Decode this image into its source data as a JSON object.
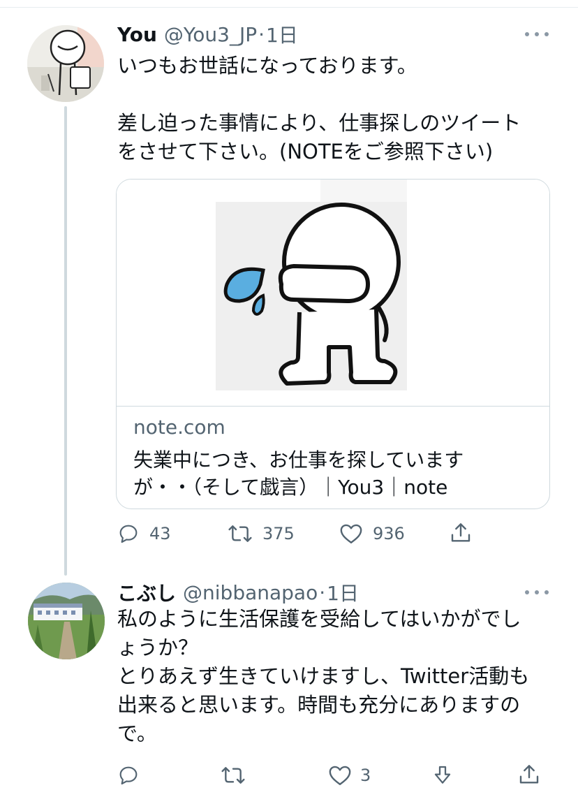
{
  "tweets": [
    {
      "author_name": "You",
      "handle": "@You3_JP",
      "separator": "·",
      "time": "1日",
      "text_lines": [
        "いつもお世話になっております。",
        "",
        "差し迫った事情により、仕事探しのツイート",
        "をさせて下さい。(NOTEをご参照下さい)"
      ],
      "card": {
        "domain": "note.com",
        "title_lines": [
          "失業中につき、お仕事を探しています",
          "が・・（そして戯言）｜You3｜note"
        ]
      },
      "actions": {
        "reply_count": "43",
        "retweet_count": "375",
        "like_count": "936"
      }
    },
    {
      "author_name": "こぶし",
      "handle": "@nibbanapao",
      "separator": "·",
      "time": "1日",
      "text_lines": [
        "私のように生活保護を受給してはいかがでし",
        "ょうか？",
        "とりあえず生きていけますし、Twitter活動も",
        "出来ると思います。時間も充分にありますの",
        "で。"
      ],
      "actions": {
        "like_count": "3"
      }
    }
  ],
  "icons": {
    "reply": "reply-icon",
    "retweet": "retweet-icon",
    "like": "heart-icon",
    "share": "share-icon",
    "downvote": "downvote-icon",
    "more": "more-icon"
  },
  "colors": {
    "text": "#0f1419",
    "secondary": "#536471",
    "border": "#cfd9de",
    "tear": "#5aaee0"
  }
}
